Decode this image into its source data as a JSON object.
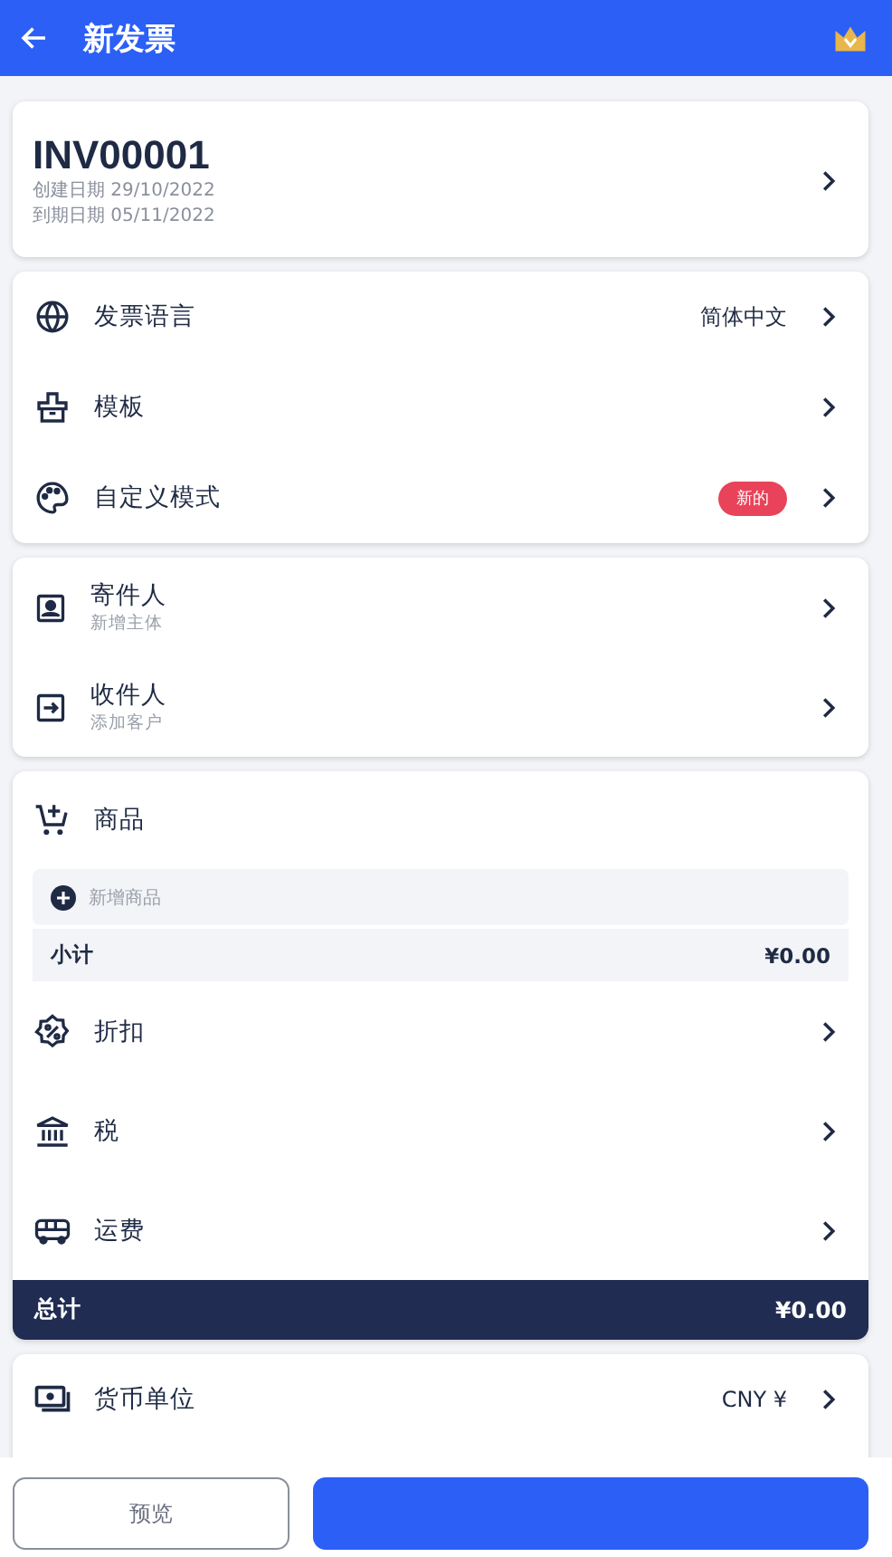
{
  "header": {
    "title": "新发票"
  },
  "invoice": {
    "number": "INV00001",
    "created": "创建日期 29/10/2022",
    "due": "到期日期 05/11/2022"
  },
  "settings": [
    {
      "kind": "globe",
      "label": "发票语言",
      "value": "简体中文"
    },
    {
      "kind": "template",
      "label": "模板"
    },
    {
      "kind": "palette",
      "label": "自定义模式",
      "badge": "新的"
    }
  ],
  "parties": [
    {
      "kind": "sender",
      "label": "寄件人",
      "hint": "新增主体"
    },
    {
      "kind": "recipient",
      "label": "收件人",
      "hint": "添加客户"
    }
  ],
  "items": {
    "title": "商品",
    "add_label": "新增商品",
    "subtotal_label": "小计",
    "subtotal": "¥0.00"
  },
  "adjustments": [
    {
      "kind": "discount",
      "label": "折扣"
    },
    {
      "kind": "tax",
      "label": "税"
    },
    {
      "kind": "shipping",
      "label": "运费"
    }
  ],
  "total": {
    "label": "总计",
    "value": "¥0.00"
  },
  "currency": {
    "label": "货币单位",
    "value": "CNY ¥"
  },
  "actions": [
    {
      "kind": "secondary",
      "label": "预览"
    },
    {
      "kind": "primary"
    }
  ]
}
